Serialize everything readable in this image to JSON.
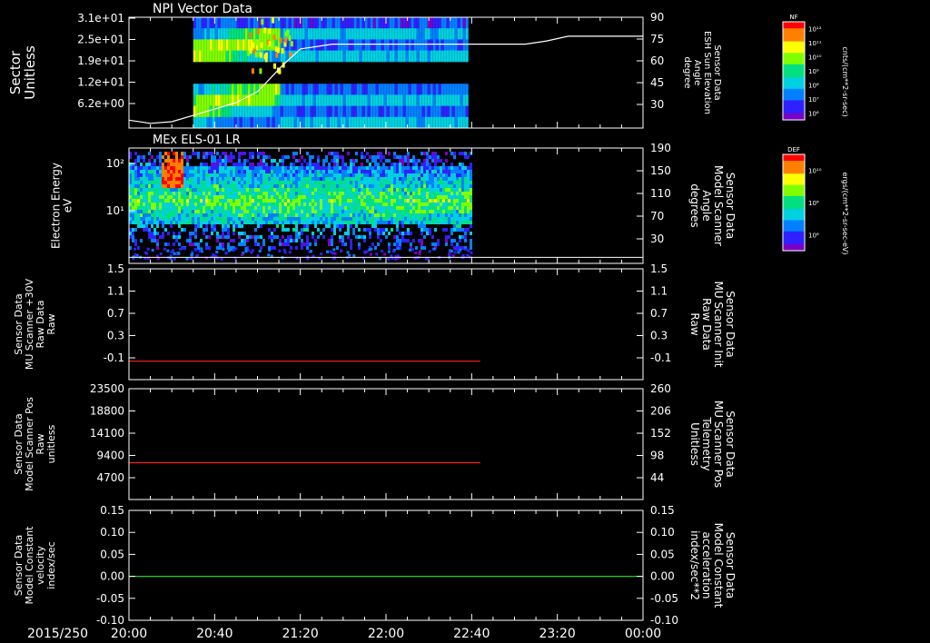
{
  "x_axis": {
    "date_label": "2015/250",
    "ticks": [
      "20:00",
      "20:40",
      "21:20",
      "22:00",
      "22:40",
      "23:20",
      "00:00"
    ]
  },
  "colors": {
    "background": "#000000",
    "axis": "#ffffff",
    "red_series": "#ff2020",
    "green_series": "#20d020",
    "palette": [
      "#7a00c8",
      "#3020ff",
      "#0080ff",
      "#00d0e0",
      "#00e080",
      "#80ff00",
      "#ffff00",
      "#ff8000",
      "#ff0000"
    ]
  },
  "chart_data": [
    {
      "type": "heatmap",
      "title": "NPI Vector Data",
      "ylabel": [
        "Sector",
        "Unitless"
      ],
      "y_ticks": [
        "3.1e+01",
        "2.5e+01",
        "1.9e+01",
        "1.2e+01",
        "6.2e+00"
      ],
      "right_ylabel": [
        "Sensor Data",
        "ESH Sun Elevation",
        "Angle",
        "degree"
      ],
      "right_ticks": [
        "90",
        "75",
        "60",
        "45",
        "30"
      ],
      "ylim_right": [
        20,
        90
      ],
      "colorbar": {
        "title": "NF",
        "ticks": [
          "10¹²",
          "10¹¹",
          "10¹⁰",
          "10⁹",
          "10⁸",
          "10⁷",
          "10⁶"
        ],
        "units": "cnts/(cm**2-sr-sec)"
      },
      "data_span": [
        "20:30",
        "22:38"
      ],
      "overlay_line": {
        "name": "ESH Sun Elevation Angle",
        "x": [
          "20:00",
          "20:10",
          "20:20",
          "20:35",
          "20:50",
          "21:00",
          "21:05",
          "21:12",
          "21:20",
          "21:35",
          "22:00",
          "23:05",
          "23:15",
          "23:25",
          "00:00"
        ],
        "y": [
          25,
          23,
          24,
          30,
          36,
          43,
          50,
          60,
          70,
          73,
          73,
          73,
          75,
          78,
          78
        ]
      }
    },
    {
      "type": "heatmap",
      "title": "MEx ELS-01 LR",
      "ylabel": [
        "Electron Energy",
        "eV"
      ],
      "y_ticks": [
        "10²",
        "10¹"
      ],
      "right_ylabel": [
        "Sensor Data",
        "Model Scanner",
        "Angle",
        "degrees"
      ],
      "right_ticks": [
        "190",
        "150",
        "110",
        "70",
        "30"
      ],
      "ylim_right": [
        0,
        190
      ],
      "colorbar": {
        "title": "DEF",
        "ticks": [
          "10¹⁰",
          "10⁸",
          "10⁶"
        ],
        "units": "ergs/(cm**2-sr-sec-eV)"
      },
      "data_span": [
        "20:00",
        "22:40"
      ],
      "overlay_line": {
        "name": "Model Scanner Angle",
        "x": [
          "20:00",
          "00:00"
        ],
        "y": [
          10,
          10
        ]
      }
    },
    {
      "type": "line",
      "ylabel": [
        "Sensor Data",
        "MU Scanner +30V",
        "Raw Data",
        "Raw"
      ],
      "y_ticks": [
        "1.5",
        "1.1",
        "0.7",
        "0.3",
        "-0.1"
      ],
      "ylim": [
        -0.3,
        1.5
      ],
      "right_ylabel": [
        "Sensor Data",
        "MU Scanner Init",
        "Raw Data",
        "Raw"
      ],
      "right_ticks": [
        "1.5",
        "1.1",
        "0.7",
        "0.3",
        "-0.1"
      ],
      "series": [
        {
          "x": [
            "20:00",
            "22:44"
          ],
          "y": [
            0.0,
            0.0
          ]
        }
      ]
    },
    {
      "type": "line",
      "ylabel": [
        "Sensor Data",
        "Model Scanner Pos",
        "Raw",
        "unitless"
      ],
      "y_ticks": [
        "23500",
        "18800",
        "14100",
        "9400",
        "4700"
      ],
      "ylim": [
        0,
        23500
      ],
      "right_ylabel": [
        "Sensor Data",
        "MU Scanner Pos",
        "Telemetry",
        "Unitless"
      ],
      "right_ticks": [
        "260",
        "206",
        "152",
        "98",
        "44"
      ],
      "series": [
        {
          "x": [
            "20:00",
            "22:44"
          ],
          "y": [
            7800,
            7800
          ]
        }
      ]
    },
    {
      "type": "line",
      "ylabel": [
        "Sensor Data",
        "Model Constant",
        "velocity",
        "index/sec"
      ],
      "y_ticks": [
        "0.15",
        "0.10",
        "0.05",
        "0.00",
        "-0.05",
        "-0.10"
      ],
      "ylim": [
        -0.1,
        0.15
      ],
      "right_ylabel": [
        "Sensor Data",
        "Model Constant",
        "acceleration",
        "index/sec**2"
      ],
      "right_ticks": [
        "0.15",
        "0.10",
        "0.05",
        "0.00",
        "-0.05",
        "-0.10"
      ],
      "series": [
        {
          "x": [
            "20:00",
            "00:00"
          ],
          "y": [
            0.0,
            0.0
          ]
        }
      ]
    }
  ]
}
